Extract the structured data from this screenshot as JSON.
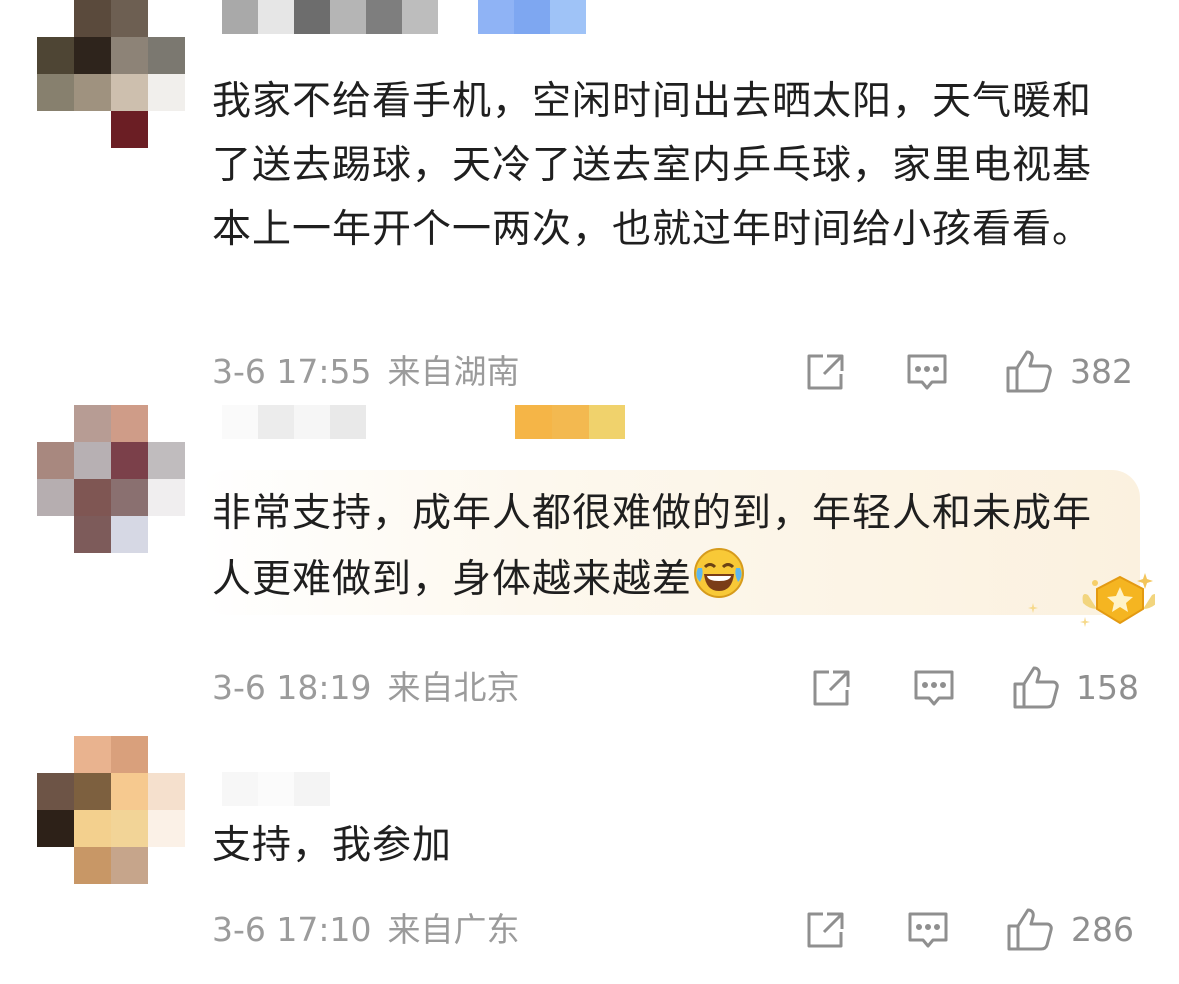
{
  "comments": [
    {
      "text": "我家不给看手机，空闲时间出去晒太阳，天气暖和了送去踢球，天冷了送去室内乒乓球，家里电视基本上一年开个一两次，也就过年时间给小孩看看。",
      "date": "3-6 17:55",
      "location": "来自湖南",
      "likes": "382"
    },
    {
      "text": "非常支持，成年人都很难做的到，年轻人和未成年人更难做到，身体越来越差",
      "emoji": "laugh-cry-emoji",
      "date": "3-6 18:19",
      "location": "来自北京",
      "likes": "158"
    },
    {
      "text": "支持，我参加",
      "date": "3-6 17:10",
      "location": "来自广东",
      "likes": "286"
    }
  ],
  "icons": {
    "share": "share-icon",
    "reply": "comment-icon",
    "like": "thumb-up-icon",
    "badge": "star-badge-icon"
  },
  "colors": {
    "text": "#1f1f1f",
    "meta": "#9b9b9b",
    "icon": "#8f8f8f",
    "highlight": "#fbf1df",
    "badge": "#f5b521"
  }
}
